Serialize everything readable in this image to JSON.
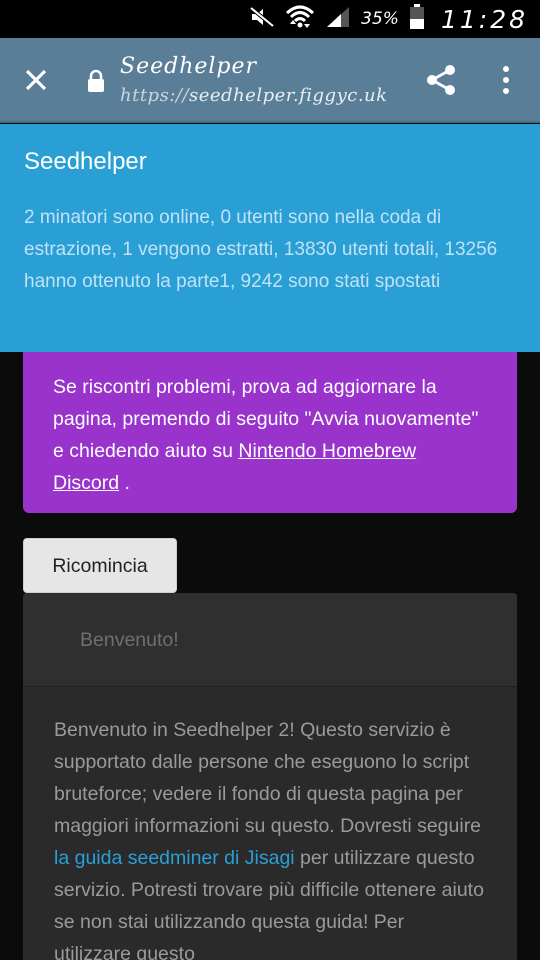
{
  "status_bar": {
    "battery_percent": "35%",
    "time": "11:28",
    "icons": [
      "mute-icon",
      "wifi-icon",
      "signal-icon",
      "battery-icon"
    ]
  },
  "browser": {
    "page_title": "Seedhelper",
    "url_scheme": "https://",
    "url_host": "seedhelper.figgyc.uk",
    "icons": [
      "close-icon",
      "lock-icon",
      "share-icon",
      "more-vert-icon"
    ]
  },
  "header": {
    "title": "Seedhelper",
    "stats": "2 minatori sono online, 0 utenti sono nella coda di estrazione, 1 vengono estratti, 13830 utenti totali, 13256 hanno ottenuto la parte1, 9242 sono stati spostati"
  },
  "alert": {
    "text_before": "Se riscontri problemi, prova ad aggiornare la pagina, premendo di seguito \"Avvia nuovamente\" e chiedendo aiuto su ",
    "link": "Nintendo Homebrew Discord",
    "text_after": " ."
  },
  "restart_button": {
    "label": "Ricomincia"
  },
  "card": {
    "title": "Benvenuto!",
    "body_before": "Benvenuto in Seedhelper 2! Questo servizio è supportato dalle persone che eseguono lo script bruteforce; vedere il fondo di questa pagina per maggiori informazioni su questo. Dovresti seguire ",
    "link": "la guida seedminer di Jisagi",
    "body_after": " per utilizzare questo servizio. Potresti trovare più difficile ottenere aiuto se non stai utilizzando questa guida! Per utilizzare questo"
  },
  "colors": {
    "toolbar": "#5b7e98",
    "header": "#2a9fd6",
    "alert": "#9933cc",
    "card": "#2a2a2a",
    "link": "#2a9fd6"
  }
}
